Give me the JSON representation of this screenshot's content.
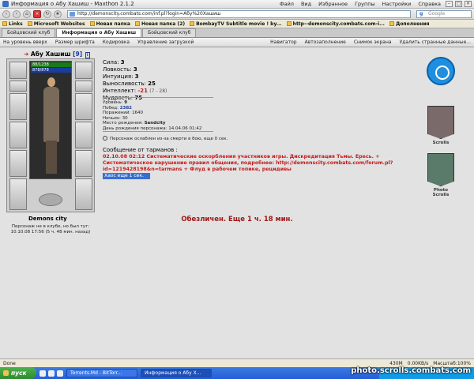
{
  "window": {
    "title": "Информация о Абу Хашиш - Maxthon 2.1.2",
    "menu": [
      "Файл",
      "Вид",
      "Избранное",
      "Группы",
      "Настройки",
      "Справка"
    ]
  },
  "nav": {
    "url": "http://demonscity.combats.com/inf.pl?login=Абу%20Хашиш",
    "search_placeholder": "Google"
  },
  "links_bar": [
    "Links",
    "Microsoft Websites",
    "Новая папка",
    "Новая папка (2)",
    "BombayTV Subtitle movie ! by...",
    "http--demonscity.combats.com-i...",
    "Дополнения"
  ],
  "tabs": [
    {
      "label": "Бойцовский клуб",
      "active": false
    },
    {
      "label": "Информация о Абу Хашиш",
      "active": true
    },
    {
      "label": "Бойцовский клуб",
      "active": false
    }
  ],
  "plugins": [
    "На уровень вверх",
    "Размер шрифта",
    "Кодировка",
    "Управление загрузкой",
    "Навигатор",
    "Автозаполнение",
    "Снимок экрана",
    "Удалить странные данные..."
  ],
  "character": {
    "name": "Абу Хашиш",
    "level_text": "[9]",
    "hp_text": "88/1238",
    "mp_text": "878/878",
    "city": "Demons city",
    "online_text": "Персонаж не в клубе, но был тут: 10.10.08 17:56 (5 ч. 48 мин. назад)"
  },
  "stats": [
    {
      "label": "Сила:",
      "value": "3"
    },
    {
      "label": "Ловкость:",
      "value": "3"
    },
    {
      "label": "Интуиция:",
      "value": "3"
    },
    {
      "label": "Выносливость:",
      "value": "25"
    },
    {
      "label": "Интеллект:",
      "value": "-21",
      "extra": "(7 - 28)"
    },
    {
      "label": "Мудрость:",
      "value": "75"
    }
  ],
  "extra_info": [
    {
      "label": "Уровень:",
      "value": "9"
    },
    {
      "label": "Побед:",
      "value": "2382"
    },
    {
      "label": "Поражений:",
      "value": "1640"
    },
    {
      "label": "Ничьих:",
      "value": "30"
    },
    {
      "label": "Место рождения:",
      "value": "Sandcity"
    },
    {
      "label": "День рождения персонажа:",
      "value": "14.04.06 01:42"
    }
  ],
  "weakness_text": "Персонаж ослаблен из-за смерти в бою, еще 0 сек.",
  "message": {
    "header": "Сообщение от тарманов :",
    "body": "02.10.08 02:12 Систематические оскорбления участников игры. Дискредитация Тьмы. Ересь. + Систематическое нарушение правил общения, подробнее: http://demonscity.combats.com/forum.pl?id=1219428198&n=tarmans + Флуд в рабочем топике, рецидивы",
    "timer": "Хаос еще 1 сек."
  },
  "silence_text": "Обезличен. Еще 1 ч. 18 мин.",
  "side": {
    "scroll_label": "Scrolls",
    "photo_label": "Photo Scrolls"
  },
  "statusbar": {
    "done": "Done",
    "memory": "430M",
    "speed": "0.00KB/s",
    "zoom": "Масштаб:100%"
  },
  "taskbar": {
    "start": "пуск",
    "items": [
      {
        "label": "Torrents.Md - BitTorr...",
        "active": false
      },
      {
        "label": "Информация о Абу Х...",
        "active": true
      }
    ]
  },
  "watermark": "photo.scrolls.combats.com",
  "colors": {
    "message_red": "#c41a1a",
    "silence_red": "#a01818",
    "level_blue": "#1a3d9c"
  }
}
